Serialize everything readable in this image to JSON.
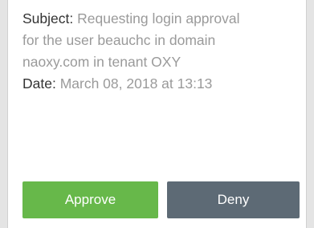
{
  "request": {
    "subject_label": "Subject:",
    "subject_line_1": "Requesting login approval",
    "subject_line_2": "for the user beauchc in domain",
    "subject_line_3": "naoxy.com in tenant OXY",
    "date_label": "Date:",
    "date_value": "March 08, 2018 at 13:13"
  },
  "actions": {
    "approve_label": "Approve",
    "deny_label": "Deny"
  },
  "colors": {
    "approve": "#67b84a",
    "deny": "#5d6a75",
    "label_text": "#333333",
    "value_text": "#9a9a9a"
  }
}
